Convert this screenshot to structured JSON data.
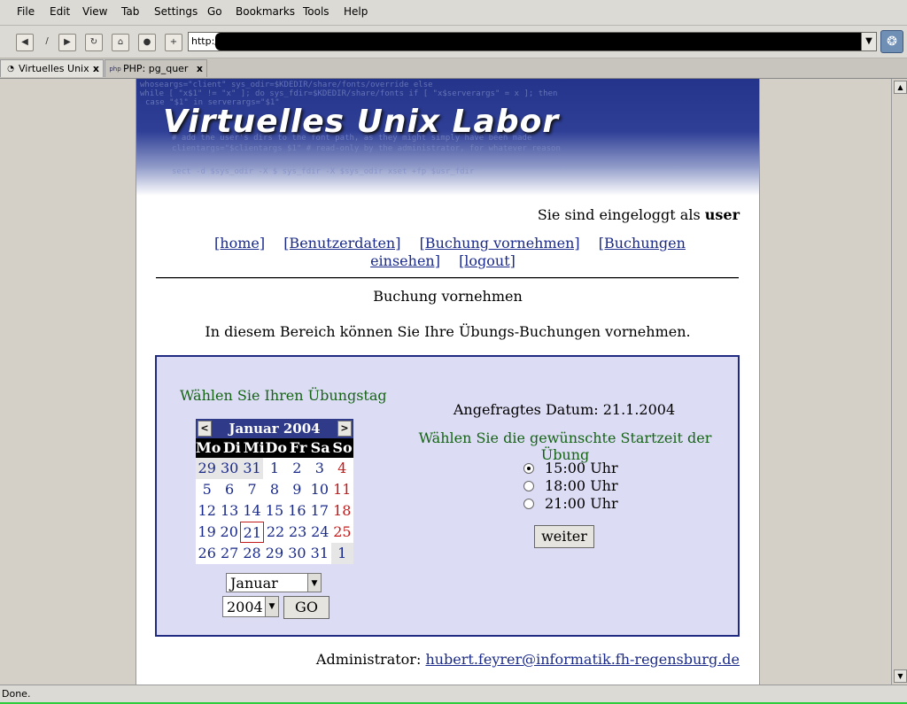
{
  "menu": [
    "File",
    "Edit",
    "View",
    "Tab",
    "Settings",
    "Go",
    "Bookmarks",
    "Tools",
    "Help"
  ],
  "url": {
    "prefix": "http://"
  },
  "tabs": [
    {
      "label": "Virtuelles Unix"
    },
    {
      "label": "PHP: pg_quer"
    }
  ],
  "status": {
    "text": "Done."
  },
  "page": {
    "logo": "Virtuelles Unix Labor",
    "login_prefix": "Sie sind eingeloggt als",
    "login_user": "user",
    "nav": [
      "[home]",
      "[Benutzerdaten]",
      "[Buchung vornehmen]",
      "[Buchungen einsehen]",
      "[logout]"
    ],
    "section_title": "Buchung vornehmen",
    "intro": "In diesem Bereich können Sie Ihre Übungs-Buchungen vornehmen.",
    "pick_day": "Wählen Sie Ihren Übungstag",
    "calendar": {
      "title": "Januar 2004",
      "prev": "<",
      "next": ">",
      "weekdays": [
        "Mo",
        "Di",
        "Mi",
        "Do",
        "Fr",
        "Sa",
        "So"
      ],
      "weeks": [
        [
          "29",
          "30",
          "31",
          "1",
          "2",
          "3",
          "4"
        ],
        [
          "5",
          "6",
          "7",
          "8",
          "9",
          "10",
          "11"
        ],
        [
          "12",
          "13",
          "14",
          "15",
          "16",
          "17",
          "18"
        ],
        [
          "19",
          "20",
          "21",
          "22",
          "23",
          "24",
          "25"
        ],
        [
          "26",
          "27",
          "28",
          "29",
          "30",
          "31",
          "1"
        ]
      ],
      "selected_day": "21"
    },
    "month_select": "Januar",
    "year_select": "2004",
    "go_label": "GO",
    "requested_date": "Angefragtes Datum: 21.1.2004",
    "start_time_prompt": "Wählen Sie die gewünschte Startzeit der Übung",
    "times": [
      {
        "label": "15:00 Uhr",
        "selected": true
      },
      {
        "label": "18:00 Uhr",
        "selected": false
      },
      {
        "label": "21:00 Uhr",
        "selected": false
      }
    ],
    "weiter_label": "weiter",
    "admin_prefix": "Administrator:",
    "admin_email": "hubert.feyrer@informatik.fh-regensburg.de"
  }
}
